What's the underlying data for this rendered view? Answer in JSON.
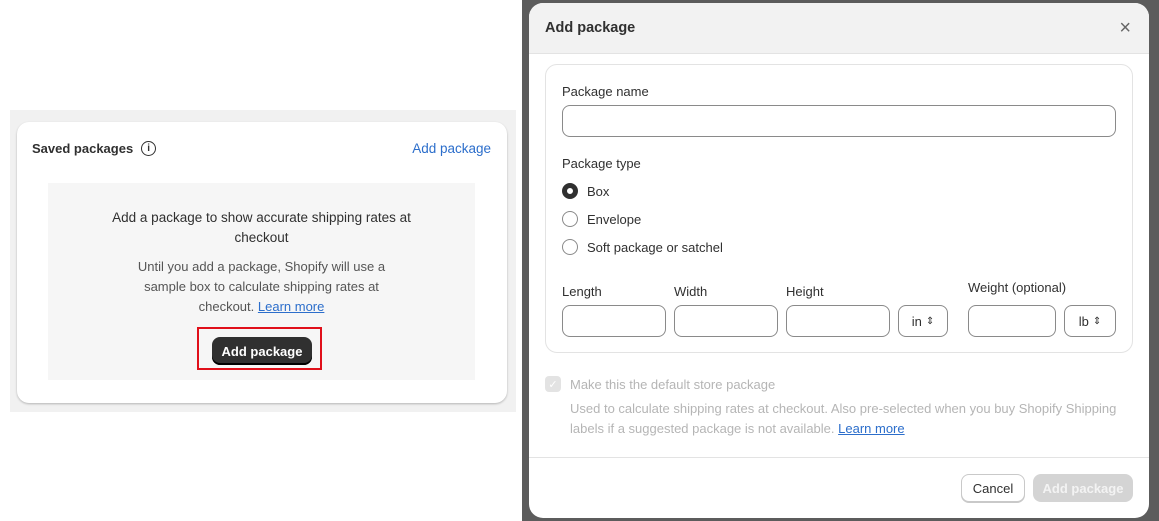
{
  "saved_packages": {
    "title": "Saved packages",
    "info_icon": "i",
    "add_link": "Add package",
    "empty_heading": "Add a package to show accurate shipping rates at checkout",
    "empty_body": "Until you add a package, Shopify will use a sample box to calculate shipping rates at checkout.",
    "learn_more": "Learn more",
    "add_button": "Add package",
    "highlight_color": "#e0101a"
  },
  "modal": {
    "title": "Add package",
    "close_icon": "×",
    "package_name_label": "Package name",
    "package_name_value": "",
    "package_type_label": "Package type",
    "types": [
      {
        "label": "Box",
        "selected": true
      },
      {
        "label": "Envelope",
        "selected": false
      },
      {
        "label": "Soft package or satchel",
        "selected": false
      }
    ],
    "length_label": "Length",
    "width_label": "Width",
    "height_label": "Height",
    "dimension_unit": "in",
    "weight_label": "Weight (optional)",
    "weight_unit": "lb",
    "default_checkbox_label": "Make this the default store package",
    "default_checked": true,
    "default_help": "Used to calculate shipping rates at checkout. Also pre-selected when you buy Shopify Shipping labels if a suggested package is not available.",
    "learn_more": "Learn more",
    "cancel": "Cancel",
    "submit": "Add package"
  }
}
